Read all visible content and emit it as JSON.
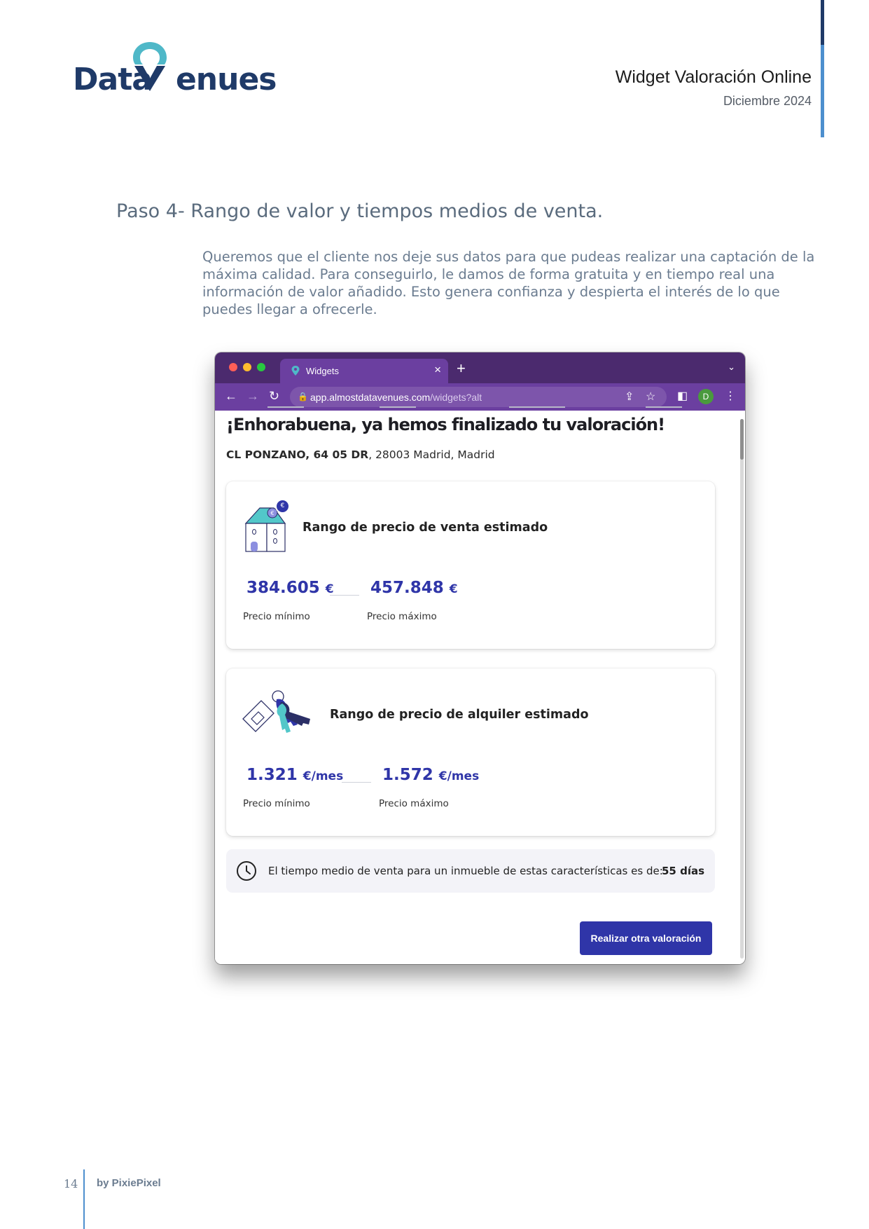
{
  "header": {
    "logo_text": "DataVenues",
    "logo_part1": "Data",
    "logo_part2": "enues",
    "doc_title": "Widget Valoración Online",
    "doc_date": "Diciembre 2024"
  },
  "section": {
    "title": "Paso 4- Rango de valor y tiempos medios de venta.",
    "intro": "Queremos que el cliente nos deje sus datos para que pudeas realizar una captación de la máxima calidad. Para conseguirlo, le damos de forma gratuita y en tiempo real una información de valor añadido. Esto genera confianza y despierta el interés de lo que puedes llegar a ofrecerle."
  },
  "browser": {
    "tab_label": "Widgets",
    "url_host": "app.almostdatavenues.com",
    "url_path": "/widgets?alt",
    "avatar_initial": "D"
  },
  "widget": {
    "heading": "¡Enhorabuena, ya hemos finalizado tu valoración!",
    "address_bold": "CL PONZANO, 64 05 DR",
    "address_rest": ", 28003 Madrid, Madrid",
    "sale": {
      "title": "Rango de precio de venta estimado",
      "min_value": "384.605",
      "min_unit": "€",
      "min_label": "Precio mínimo",
      "max_value": "457.848",
      "max_unit": "€",
      "max_label": "Precio máximo",
      "badge": "€"
    },
    "rent": {
      "title": "Rango de precio de alquiler estimado",
      "min_value": "1.321",
      "min_unit": "€/mes",
      "min_label": "Precio mínimo",
      "max_value": "1.572",
      "max_unit": "€/mes",
      "max_label": "Precio máximo"
    },
    "sale_time": {
      "text": "El tiempo medio de venta para un inmueble de estas características es de:",
      "value": "55 días"
    },
    "cta_label": "Realizar otra valoración"
  },
  "footer": {
    "page_number": "14",
    "by": "by PixiePixel"
  },
  "colors": {
    "brand_navy": "#1f3a68",
    "brand_teal": "#4fb8c8",
    "price_blue": "#2f35a8",
    "tab_purple": "#6b3fa0"
  }
}
